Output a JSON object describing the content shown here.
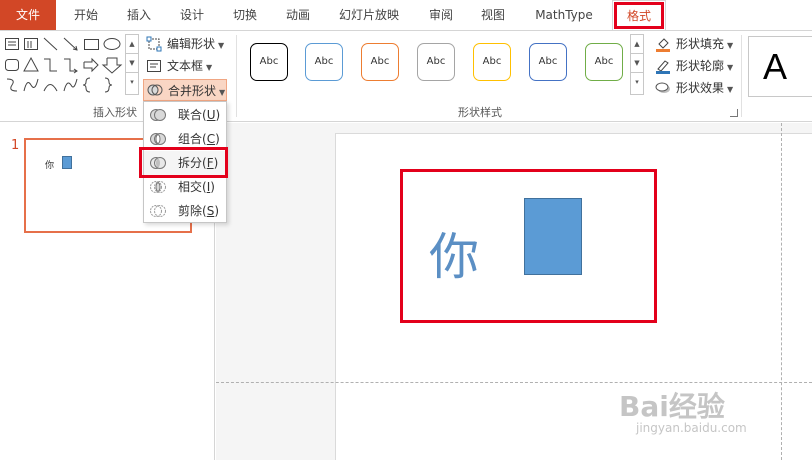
{
  "tabs": [
    {
      "label": "文件"
    },
    {
      "label": "开始"
    },
    {
      "label": "插入"
    },
    {
      "label": "设计"
    },
    {
      "label": "切换"
    },
    {
      "label": "动画"
    },
    {
      "label": "幻灯片放映"
    },
    {
      "label": "审阅"
    },
    {
      "label": "视图"
    },
    {
      "label": "MathType"
    },
    {
      "label": "格式"
    }
  ],
  "ribbon": {
    "insert_shapes": {
      "label": "插入形状",
      "edit_shape": "编辑形状",
      "text_box": "文本框",
      "merge_shapes": "合并形状"
    },
    "shape_styles": {
      "label": "形状样式",
      "swatches": [
        {
          "text": "Abc",
          "color": "#000000"
        },
        {
          "text": "Abc",
          "color": "#5b9bd5"
        },
        {
          "text": "Abc",
          "color": "#ed7d31"
        },
        {
          "text": "Abc",
          "color": "#a5a5a5"
        },
        {
          "text": "Abc",
          "color": "#ffc000"
        },
        {
          "text": "Abc",
          "color": "#4472c4"
        },
        {
          "text": "Abc",
          "color": "#70ad47"
        }
      ],
      "fill": "形状填充",
      "outline": "形状轮廓",
      "effects": "形状效果"
    },
    "wordart_preview": "A"
  },
  "merge_menu": {
    "items": [
      {
        "label": "联合",
        "key": "U"
      },
      {
        "label": "组合",
        "key": "C"
      },
      {
        "label": "拆分",
        "key": "F"
      },
      {
        "label": "相交",
        "key": "I"
      },
      {
        "label": "剪除",
        "key": "S"
      }
    ]
  },
  "thumbnails": {
    "slide_number": "1",
    "char": "你"
  },
  "slide": {
    "char": "你"
  },
  "watermark": {
    "logo": "Bai经验",
    "url": "jingyan.baidu.com"
  },
  "colors": {
    "accent": "#d24726",
    "highlight": "#e3001b",
    "shape_fill": "#5b9bd5"
  }
}
